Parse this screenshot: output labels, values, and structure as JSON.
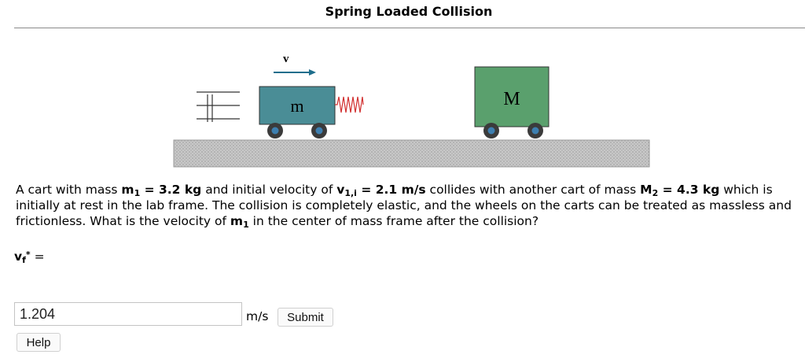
{
  "page": {
    "title": "Spring Loaded Collision"
  },
  "figure": {
    "velocity_label": "v",
    "cart_small_label": "m",
    "cart_large_label": "M",
    "colors": {
      "cart_small": "#4a8d96",
      "cart_large": "#5aa06d",
      "ground": "#bfbfbf",
      "arrow": "#1e6e8c",
      "spring": "#d23030"
    }
  },
  "problem": {
    "t1": "A cart with mass ",
    "m1_var": "m",
    "m1_sub": "1",
    "m1_val": " = 3.2 kg",
    "t2": " and initial velocity of ",
    "v_var": "v",
    "v_sub": "1,i",
    "v_val": " = 2.1 m/s",
    "t3": " collides with another cart of mass ",
    "m2_var": "M",
    "m2_sub": "2",
    "m2_val": " = 4.3 kg",
    "t4": " which is initially at rest in the lab frame. The collision is completely elastic, and the wheels on the carts can be treated as massless and frictionless. What is the velocity of ",
    "m1b_var": "m",
    "m1b_sub": "1",
    "t5": " in the center of mass frame after the collision?"
  },
  "answer": {
    "var": "v",
    "sub": "f",
    "sup": "*",
    "eq": " =",
    "value": "1.204",
    "units": "m/s",
    "submit_label": "Submit",
    "help_label": "Help"
  }
}
